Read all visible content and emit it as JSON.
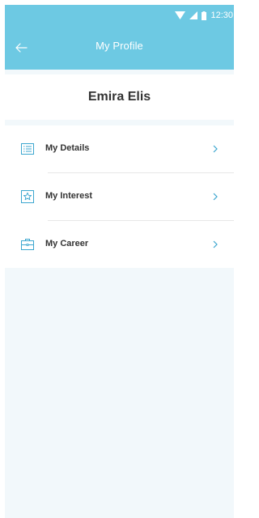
{
  "statusbar": {
    "time": "12:30"
  },
  "header": {
    "title": "My Profile",
    "back_icon": "arrow-left-icon"
  },
  "profile": {
    "name": "Emira Elis"
  },
  "menu": {
    "items": [
      {
        "label": "My Details",
        "icon": "list-icon"
      },
      {
        "label": "My Interest",
        "icon": "star-icon"
      },
      {
        "label": "My Career",
        "icon": "briefcase-icon"
      }
    ]
  },
  "colors": {
    "accent": "#6dc9e3",
    "background": "#f2f8fb",
    "text": "#333333",
    "icon": "#3ba6cf"
  }
}
